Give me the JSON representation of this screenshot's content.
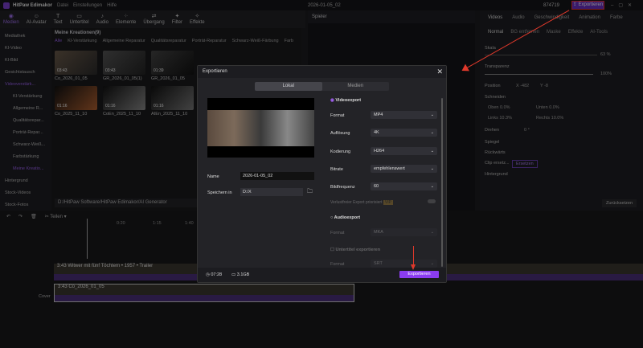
{
  "app": {
    "name": "HitPaw Edimakor",
    "menu": [
      "Datei",
      "Einstellungen",
      "Hilfe"
    ],
    "project": "2026-01-05_02",
    "credits": "874719",
    "export_label": "Exportieren"
  },
  "toolbar": [
    "Medien",
    "AI-Avatar",
    "Text",
    "Untertitel",
    "Audio",
    "Elemente",
    "Übergang",
    "Filter",
    "Effekte"
  ],
  "sidebar": [
    {
      "label": "Mediathek"
    },
    {
      "label": "KI-Video"
    },
    {
      "label": "KI-Bild"
    },
    {
      "label": "Gesichtstausch"
    },
    {
      "label": "Videoverstärk..."
    },
    {
      "label": "KI-Verstärkung",
      "sub": true
    },
    {
      "label": "Allgemeine R...",
      "sub": true
    },
    {
      "label": "Qualitätsrepar...",
      "sub": true
    },
    {
      "label": "Porträt-Repar...",
      "sub": true
    },
    {
      "label": "Schwarz-Weiß...",
      "sub": true
    },
    {
      "label": "Farbstärkung",
      "sub": true
    },
    {
      "label": "Meine Kreatio...",
      "sub": true,
      "active": true
    },
    {
      "label": "Hintergrund"
    },
    {
      "label": "Stock-Videos"
    },
    {
      "label": "Stock-Fotos"
    }
  ],
  "media": {
    "title": "Meine Kreationen(9)",
    "filters": [
      "Alle",
      "KI-Verstärkung",
      "Allgemeine Reparatur",
      "Qualitätsreparatur",
      "Porträt-Reparatur",
      "Schwarz-Weiß-Färbung",
      "Farb"
    ],
    "items": [
      {
        "name": "Co_2026_01_05",
        "duration": "03:43"
      },
      {
        "name": "GR_2026_01_05(1)",
        "duration": "03:43"
      },
      {
        "name": "GR_2026_01_05",
        "duration": "01:39"
      },
      {
        "name": "Co_2025_11_10",
        "duration": "01:16"
      },
      {
        "name": "CoEn_2025_11_10",
        "duration": "01:16"
      },
      {
        "name": "AIEn_2025_11_10",
        "duration": "01:16"
      }
    ],
    "path": "D:/HitPaw Software/HitPaw Edimakor/AI Generator"
  },
  "player": {
    "title": "Spieler"
  },
  "right": {
    "tabs": [
      "Videos",
      "Audio",
      "Geschwindigkeit",
      "Animation",
      "Farbe"
    ],
    "subtabs": [
      "Normal",
      "BG entfernen",
      "Maske",
      "Effekte",
      "AI-Tools"
    ],
    "scale_label": "Skala",
    "scale": "63 %",
    "transparency_label": "Transparenz",
    "transparency": "100%",
    "position_label": "Position",
    "pos_x": "X -482",
    "pos_y": "Y -8",
    "crop_label": "Schneiden",
    "top": "Oben",
    "top_v": "0.0%",
    "bottom": "Unten",
    "bottom_v": "0.0%",
    "left": "Links",
    "left_v": "10.3%",
    "right": "Rechts",
    "right_v": "10.0%",
    "rotate_label": "Drehen",
    "rotate": "0 °",
    "mirror_label": "Spiegel",
    "reverse_label": "Rückwärts",
    "replace_label": "Clip ersetz...",
    "replace_btn": "Ersetzen",
    "bg_label": "Hintergrund",
    "reset": "Zurücksetzen"
  },
  "timeline": {
    "split": "Teilen",
    "ticks": [
      "0:20",
      "1:15",
      "1:40"
    ],
    "track1": "3:43 Witwer mit fünf Töchtern • 1957 • Trailer",
    "track2": "3:43 Co_2026_01_05",
    "cover": "Cover"
  },
  "dialog": {
    "title": "Exportieren",
    "tabs": [
      "Lokal",
      "Medien"
    ],
    "name_label": "Name",
    "name": "2026-01-05_02",
    "save_label": "Speichern in",
    "save_path": "D:/X",
    "video_export": "Videoexport",
    "format_label": "Format",
    "format": "MP4",
    "res_label": "Auflösung",
    "res": "4K",
    "enc_label": "Kodierung",
    "enc": "H264",
    "bitrate_label": "Bitrate",
    "bitrate": "empfehlenswert",
    "fps_label": "Bildfrequenz",
    "fps": "60",
    "priority": "Verlustfreier Export priorisiert",
    "vip": "VIP",
    "audio_export": "Audioexport",
    "a_format_label": "Format",
    "a_format": "MKA",
    "subtitle": "Untertitel exportieren",
    "s_format_label": "Format",
    "s_format": "SRT",
    "duration": "07:28",
    "size": "3.1GB",
    "export_btn": "Exportieren"
  },
  "colors": {
    "accent": "#8b3cf0",
    "arrow": "#e0392b"
  }
}
